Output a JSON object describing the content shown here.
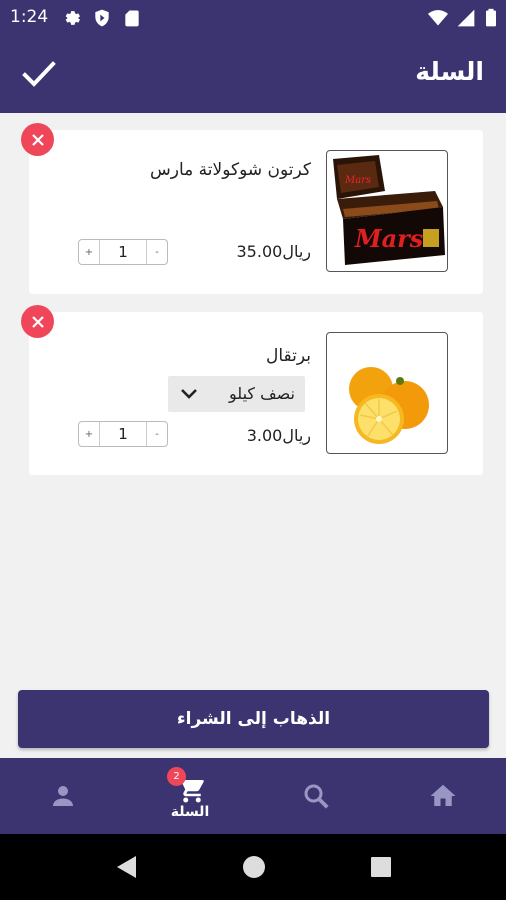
{
  "status_bar": {
    "time": "1:24"
  },
  "app_bar": {
    "title": "السلة"
  },
  "cart_items": [
    {
      "name": "كرتون شوكولاتة مارس",
      "price": "35.00ريال",
      "quantity": "1",
      "image": "mars-box"
    },
    {
      "name": "برتقال",
      "price": "3.00ريال",
      "quantity": "1",
      "unit": "نصف كيلو",
      "image": "oranges"
    }
  ],
  "stepper": {
    "minus": "-",
    "plus": "+"
  },
  "checkout": {
    "label": "الذهاب إلى الشراء"
  },
  "bottom_nav": {
    "cart_label": "السلة",
    "cart_badge": "2",
    "items": [
      "home-icon",
      "search-icon",
      "cart-icon",
      "person-icon"
    ]
  },
  "colors": {
    "primary": "#3b3470",
    "accent": "#f0465a",
    "background": "#f1f1f1"
  }
}
